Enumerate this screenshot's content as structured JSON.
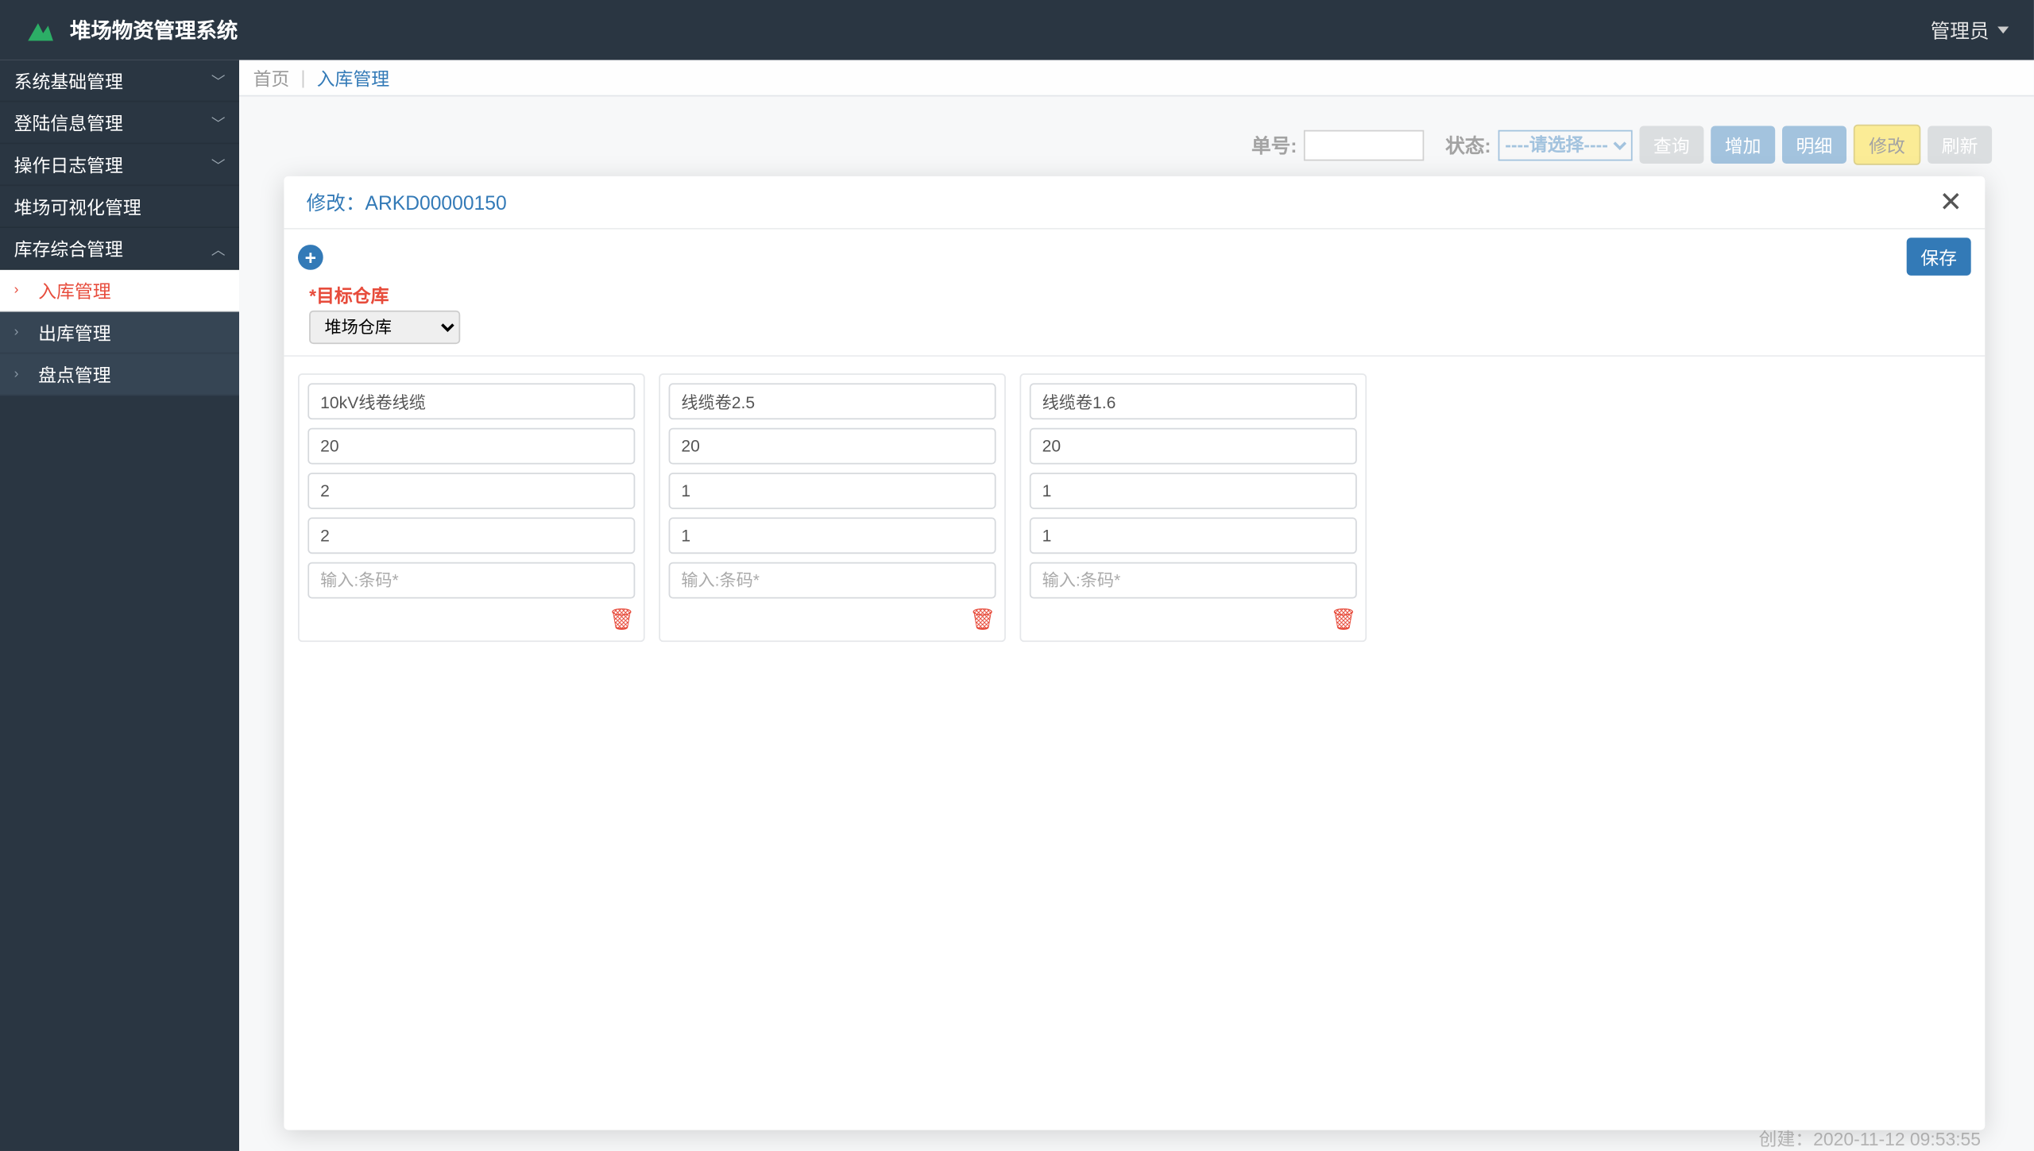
{
  "app_title": "堆场物资管理系统",
  "user_label": "管理员",
  "sidebar": {
    "items": [
      {
        "label": "系统基础管理",
        "expandable": true
      },
      {
        "label": "登陆信息管理",
        "expandable": true
      },
      {
        "label": "操作日志管理",
        "expandable": true
      },
      {
        "label": "堆场可视化管理",
        "expandable": false
      },
      {
        "label": "库存综合管理",
        "expandable": true,
        "expanded": true
      }
    ],
    "subs": [
      {
        "label": "入库管理",
        "active": true
      },
      {
        "label": "出库管理",
        "active": false
      },
      {
        "label": "盘点管理",
        "active": false
      }
    ]
  },
  "breadcrumb": {
    "home": "首页",
    "current": "入库管理"
  },
  "toolbar": {
    "order_label": "单号:",
    "status_label": "状态:",
    "status_placeholder": "----请选择----",
    "btn_query": "查询",
    "btn_add": "增加",
    "btn_detail": "明细",
    "btn_edit": "修改",
    "btn_refresh": "刷新"
  },
  "modal": {
    "title_prefix": "修改：",
    "order_id": "ARKD00000150",
    "save_label": "保存",
    "target_label": "*目标仓库",
    "target_value": "堆场仓库",
    "barcode_placeholder": "输入:条码*",
    "cards": [
      {
        "name": "10kV线卷线缆",
        "f1": "20",
        "f2": "2",
        "f3": "2"
      },
      {
        "name": "线缆卷2.5",
        "f1": "20",
        "f2": "1",
        "f3": "1"
      },
      {
        "name": "线缆卷1.6",
        "f1": "20",
        "f2": "1",
        "f3": "1"
      }
    ]
  },
  "footer": {
    "created_prefix": "创建：",
    "created_ts": "2020-11-12 09:53:55"
  }
}
